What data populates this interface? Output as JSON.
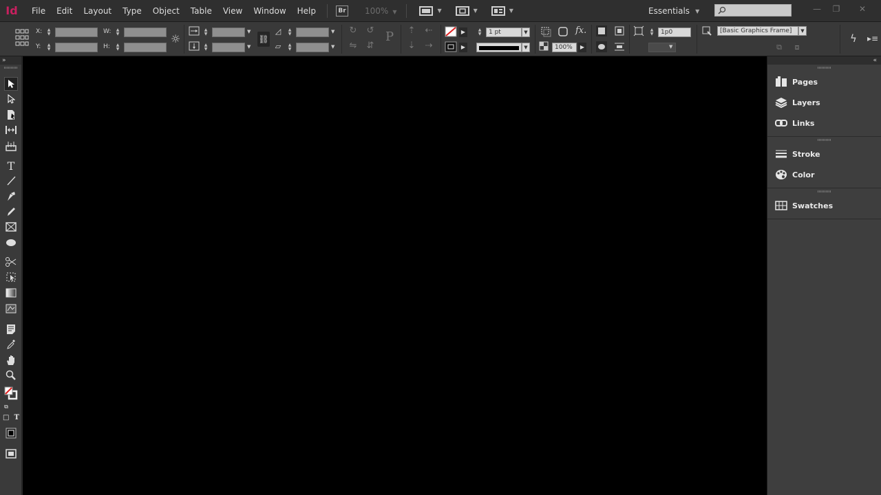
{
  "app": {
    "logo": "Id",
    "accent": "#c8205f"
  },
  "menu": [
    "File",
    "Edit",
    "Layout",
    "Type",
    "Object",
    "Table",
    "View",
    "Window",
    "Help"
  ],
  "menubar": {
    "bridge_label": "Br",
    "zoom": "100%",
    "workspace": "Essentials",
    "search_placeholder": ""
  },
  "control": {
    "x_label": "X:",
    "y_label": "Y:",
    "w_label": "W:",
    "h_label": "H:",
    "stroke_weight": "1 pt",
    "opacity": "100%",
    "fitting_value": "1p0",
    "object_style": "[Basic Graphics Frame]"
  },
  "toolbox": {
    "header": "»",
    "fill_stroke_text": "T"
  },
  "dock": {
    "header": "«",
    "groups": [
      [
        {
          "label": "Pages",
          "icon": "pages-icon"
        },
        {
          "label": "Layers",
          "icon": "layers-icon"
        },
        {
          "label": "Links",
          "icon": "links-icon"
        }
      ],
      [
        {
          "label": "Stroke",
          "icon": "stroke-icon"
        },
        {
          "label": "Color",
          "icon": "color-icon"
        }
      ],
      [
        {
          "label": "Swatches",
          "icon": "swatches-icon"
        }
      ]
    ]
  },
  "colors": {
    "canvas": "#000000",
    "dock": "#3e3e3e",
    "control_bar": "#393939",
    "menubar": "#2f2f2f"
  }
}
